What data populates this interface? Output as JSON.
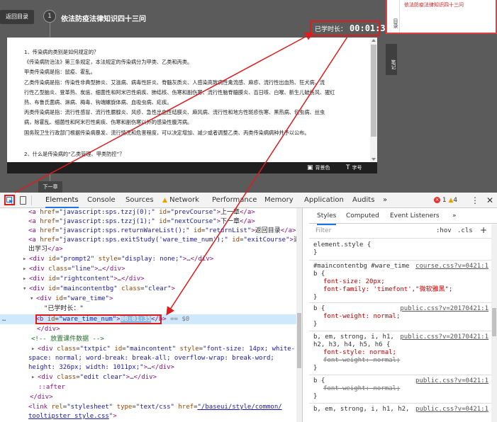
{
  "player": {
    "back_label": "返回目录",
    "step_number": "1",
    "chapter_title": "依法防疫法律知识四十三问",
    "timer_label": "已学时长：",
    "timer_value": "00:01:35",
    "next_label": "下一章",
    "content": [
      {
        "text": "1、传染病的类别是如何规定的？",
        "cls": "q"
      },
      {
        "text": "《传染病防治法》第三条规定，本法规定的传染病分为甲类、乙类和丙类。",
        "cls": ""
      },
      {
        "text": "甲类传染病是指：鼠疫、霍乱。",
        "cls": ""
      },
      {
        "text": "乙类传染病是指：传染性非典型肺炎、艾滋病、病毒性肝炎、脊髓灰质炎、人感染高致病性禽流感、麻疹、流行性出血热、狂犬病、流",
        "cls": ""
      },
      {
        "text": "行性乙型脑炎、登革热、炭疽、细菌性和阿米巴性痢疾、肺结核、伤寒和副伤寒、流行性脑脊髓膜炎、百日咳、白喉、新生儿破伤风、猩红",
        "cls": ""
      },
      {
        "text": "热、布鲁氏菌病、淋病、梅毒、钩端螺旋体病、血吸虫病、疟疾。",
        "cls": ""
      },
      {
        "text": "丙类传染病是指：流行性感冒、流行性腮腺炎、风疹、急性出血性结膜炎、麻风病、流行性和地方性斑疹伤寒、黑热病、包虫病、丝虫",
        "cls": ""
      },
      {
        "text": "病，除霍乱、细菌性和阿米巴性痢疾、伤寒和副伤寒以外的感染性腹泻病。",
        "cls": ""
      },
      {
        "text": "国务院卫生行政部门根据传染病暴发、流行情况和危害程度，可以决定增加、减少或者调整乙类、丙类传染病病种并予以公布。",
        "cls": ""
      },
      {
        "text": "",
        "cls": ""
      },
      {
        "text": "2、什么是传染病的“乙类管理、甲类防控”？",
        "cls": "q"
      }
    ],
    "bg_tool_label": "背景色",
    "font_tool_label": "字号",
    "side_tab_label": "目录",
    "current_title": "依法防疫法律知识四十三问",
    "notes_tab_label": "笔记"
  },
  "devtools": {
    "tabs": [
      "Elements",
      "Console",
      "Sources",
      "Network",
      "Performance",
      "Memory",
      "Application",
      "Audits"
    ],
    "more_label": "»",
    "error_count": "1",
    "warning_count": "4",
    "kebab_label": "⋮",
    "close_label": "✕",
    "styles_tabs": [
      "Styles",
      "Computed",
      "Event Listeners"
    ],
    "styles_more": "»",
    "filter_placeholder": "Filter",
    "hov_label": ":hov",
    "cls_label": ".cls",
    "plus_label": "+",
    "selected_value": "00:01:35",
    "dollar_zero": "== $0"
  },
  "elements_rows": [
    "<a href=\"javascript:sps.tzzj(0);\" id=\"prevCourse\">上一章</a>",
    "<a href=\"javascript:sps.tzzj(1);\" id=\"nextCourse\">下一章</a>",
    "<a href=\"javascript:sps.returnWareList();\" id=\"returnList\">返回目录</a>",
    "<a href=\"javascript:sps.exitStudy('ware_time_num');\" id=\"exitCourse\">退",
    "出学习</a>",
    "<div id=\"prompt2\" style=\"display: none;\">…</div>",
    "<div class=\"line\">…</div>",
    "<div id=\"rightcontent\">…</div>",
    "<div id=\"maincontentbg\" class=\"clear\">",
    "<div id=\"ware_time\">",
    "\"已学时长：\"",
    "<b id=\"ware_time_num\">00:01:35</b>",
    "</div>",
    "<!-- 放置课件数据 -->",
    "<div class=\"txtpic\" id=\"maincontent\" style=\"font-size: 14px; white-",
    "space: normal; word-break: break-all; overflow-wrap: break-word;",
    "height: 326px; width: 1011px;\">…</div>",
    "<div class=\"edit clear\">…</div>",
    "::after",
    "</div>",
    "<link rel=\"stylesheet\" type=\"text/css\" href=\"/baseui/style/common/",
    "tooltipster_style.css\">"
  ],
  "styles_rules": {
    "r0_selector": "element.style {",
    "r0_close": "}",
    "r1_selector": "#maincontentbg #ware_time",
    "r1_selector2": "b {",
    "r1_src": "course.css?v=0421:1",
    "r1_p1": "font-size: 20px;",
    "r1_p2": "font-family: 'timefont',\"微软雅黑\";",
    "r1_close": "}",
    "r2_selector": "b {",
    "r2_src": "public.css?v=20170421:1",
    "r2_p1": "font-weight: normal;",
    "r2_close": "}",
    "r3_selector": "b, em, strong, i, h1,",
    "r3_selector2": "h2, h3, h4, h5, h6 {",
    "r3_src": "public.css?v=20170421:1",
    "r3_p1": "font-style: normal;",
    "r3_p2": "font-weight: normal;",
    "r3_close": "}",
    "r4_selector": "b {",
    "r4_src": "public.css?v=0421:1",
    "r4_p1": "font-weight: normal;",
    "r4_close": "}",
    "r5_selector": "b, em, strong, i, h1, h2,",
    "r5_src": "public.css?v=0421:1"
  }
}
